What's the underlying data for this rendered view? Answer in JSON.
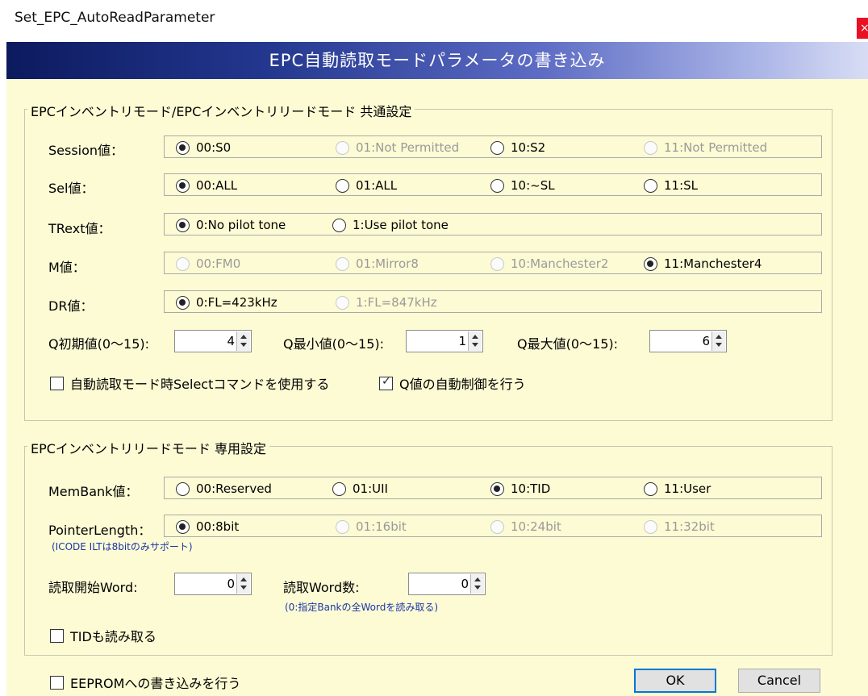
{
  "window": {
    "title": "Set_EPC_AutoReadParameter",
    "close_glyph": "×"
  },
  "banner": {
    "text": "EPC自動読取モードパラメータの書き込み"
  },
  "common": {
    "title": "EPCインベントリモード/EPCインベントリリードモード 共通設定",
    "session": {
      "label": "Session値：",
      "options": [
        "00:S0",
        "01:Not Permitted",
        "10:S2",
        "11:Not Permitted"
      ],
      "selected": "00:S0"
    },
    "sel": {
      "label": "Sel値：",
      "options": [
        "00:ALL",
        "01:ALL",
        "10:~SL",
        "11:SL"
      ],
      "selected": "00:ALL"
    },
    "trext": {
      "label": "TRext値：",
      "options": [
        "0:No pilot tone",
        "1:Use pilot tone"
      ],
      "selected": "0:No pilot tone"
    },
    "m": {
      "label": "M値：",
      "options": [
        "00:FM0",
        "01:Mirror8",
        "10:Manchester2",
        "11:Manchester4"
      ],
      "selected": "11:Manchester4"
    },
    "dr": {
      "label": "DR値：",
      "options": [
        "0:FL=423kHz",
        "1:FL=847kHz"
      ],
      "selected": "0:FL=423kHz"
    },
    "q_initial": {
      "label": "Q初期値(0～15):",
      "value": "4"
    },
    "q_min": {
      "label": "Q最小値(0～15):",
      "value": "1"
    },
    "q_max": {
      "label": "Q最大値(0～15):",
      "value": "6"
    },
    "select_cmd": {
      "label": "自動読取モード時Selectコマンドを使用する",
      "checked": false
    },
    "q_auto": {
      "label": "Q値の自動制御を行う",
      "checked": true
    }
  },
  "read": {
    "title": "EPCインベントリリードモード 専用設定",
    "membank": {
      "label": "MemBank値：",
      "options": [
        "00:Reserved",
        "01:UII",
        "10:TID",
        "11:User"
      ],
      "selected": "10:TID"
    },
    "pointer": {
      "label": "PointerLength：",
      "options": [
        "00:8bit",
        "01:16bit",
        "10:24bit",
        "11:32bit"
      ],
      "selected": "00:8bit"
    },
    "pointer_note": "(ICODE ILTは8bitのみサポート)",
    "start_word": {
      "label": "読取開始Word:",
      "value": "0"
    },
    "word_count": {
      "label": "読取Word数:",
      "value": "0"
    },
    "word_note": "(0:指定Bankの全Wordを読み取る)",
    "tid": {
      "label": "TIDも読み取る",
      "checked": false
    }
  },
  "footer": {
    "eeprom": {
      "label": "EEPROMへの書き込みを行う",
      "checked": false
    },
    "ok_label": "OK",
    "cancel_label": "Cancel"
  }
}
